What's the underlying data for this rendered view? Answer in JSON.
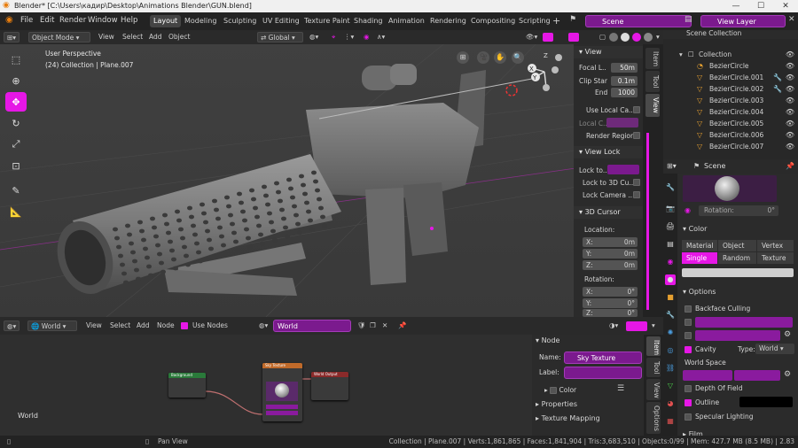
{
  "title_bar": {
    "title": "Blender* [C:\\Users\\кадир\\Desktop\\Animations Blender\\GUN.blend]"
  },
  "menu": [
    "File",
    "Edit",
    "Render",
    "Window",
    "Help"
  ],
  "workspaces": [
    "Layout",
    "Modeling",
    "Sculpting",
    "UV Editing",
    "Texture Paint",
    "Shading",
    "Animation",
    "Rendering",
    "Compositing",
    "Scripting"
  ],
  "active_workspace": "Layout",
  "scene_name": "Scene",
  "view_layer": "View Layer",
  "viewport": {
    "mode": "Object Mode",
    "menus": [
      "View",
      "Select",
      "Add",
      "Object"
    ],
    "transform_orientation": "Global",
    "overlay_line1": "User Perspective",
    "overlay_line2": "(24) Collection | Plane.007",
    "gizmo_axes": [
      "X",
      "Y",
      "Z"
    ]
  },
  "npanel": {
    "view_header": "View",
    "focal_label": "Focal L..",
    "focal_value": "50m",
    "clip_start_label": "Clip Star",
    "clip_start_value": "0.1m",
    "clip_end_label": "End",
    "clip_end_value": "1000",
    "use_local_camera": "Use Local Ca...",
    "local_camera": "Local C...",
    "render_region": "Render Region",
    "view_lock_header": "View Lock",
    "lock_to": "Lock to...",
    "lock_3d_cursor": "Lock to 3D Cu...",
    "lock_camera": "Lock Camera ...",
    "cursor_header": "3D Cursor",
    "location_label": "Location:",
    "loc_x": "0m",
    "loc_y": "0m",
    "loc_z": "0m",
    "rotation_label": "Rotation:",
    "rot_x": "0°",
    "rot_y": "0°",
    "rot_z": "0°",
    "tabs": [
      "Item",
      "Tool",
      "View"
    ]
  },
  "outliner": {
    "top_row": "Scene Collection",
    "collection": "Collection",
    "items": [
      "BezierCircle",
      "BezierCircle.001",
      "BezierCircle.002",
      "BezierCircle.003",
      "BezierCircle.004",
      "BezierCircle.005",
      "BezierCircle.006",
      "BezierCircle.007"
    ]
  },
  "properties": {
    "scene_label": "Scene",
    "rotation_label": "Rotation:",
    "rotation_value": "0°",
    "color_header": "Color",
    "color_row1": [
      "Material",
      "Object",
      "Vertex"
    ],
    "color_row2": [
      "Single",
      "Random",
      "Texture"
    ],
    "options_header": "Options",
    "backface_culling": "Backface Culling",
    "cavity": "Cavity",
    "type_label": "Type:",
    "type_value": "World",
    "world_space": "World Space",
    "depth_of_field": "Depth Of Field",
    "outline": "Outline",
    "specular": "Specular Lighting",
    "film": "Film"
  },
  "node_editor": {
    "type": "World",
    "menus": [
      "View",
      "Select",
      "Add",
      "Node"
    ],
    "use_nodes": "Use Nodes",
    "world_name": "World",
    "corner_label": "World",
    "nodes": {
      "background": "Background",
      "sky": "Sky Texture",
      "output": "World Output"
    }
  },
  "node_side": {
    "node_header": "Node",
    "name_label": "Name:",
    "name_value": "Sky Texture",
    "label_label": "Label:",
    "color": "Color",
    "properties": "Properties",
    "texture_mapping": "Texture Mapping",
    "tabs": [
      "Item",
      "Tool",
      "View",
      "Options"
    ]
  },
  "status": {
    "left_hint": "Pan View",
    "stats": "Collection | Plane.007 | Verts:1,861,865 | Faces:1,841,904 | Tris:3,683,510 | Objects:0/99 | Mem: 427.7 MB (8.5 MB) | 2.83"
  },
  "colors": {
    "accent": "#e617e6",
    "header": "#2a2a2a",
    "bg": "#3d3d3d"
  }
}
